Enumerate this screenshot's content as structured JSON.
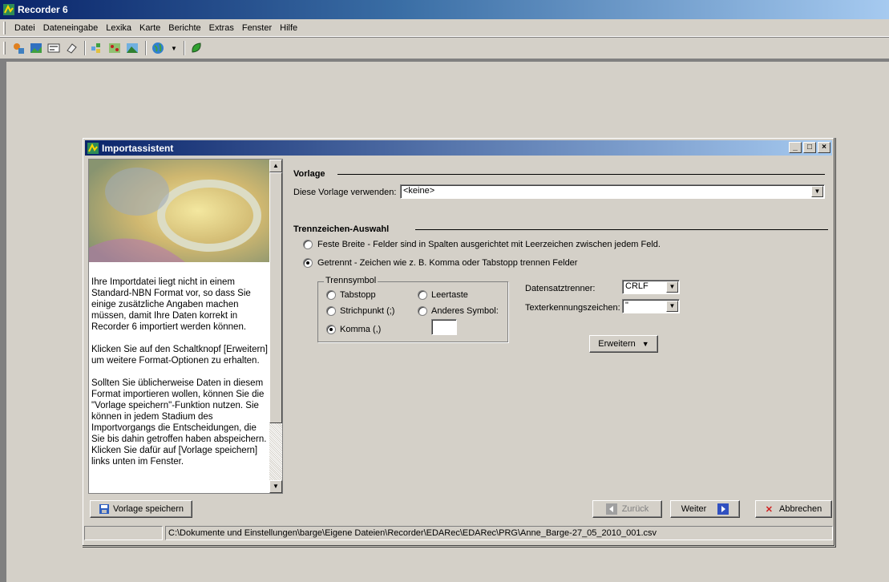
{
  "app": {
    "title": "Recorder 6",
    "menu": [
      "Datei",
      "Dateneingabe",
      "Lexika",
      "Karte",
      "Berichte",
      "Extras",
      "Fenster",
      "Hilfe"
    ]
  },
  "dialog": {
    "title": "Importassistent",
    "help_paragraphs": [
      "Ihre Importdatei liegt nicht in einem Standard-NBN Format vor, so dass Sie einige zusätzliche Angaben machen müssen, damit Ihre Daten korrekt in Recorder 6 importiert werden können.",
      "Klicken Sie auf den Schaltknopf [Erweitern] um weitere Format-Optionen zu erhalten.",
      "Sollten Sie üblicherweise Daten in diesem Format importieren wollen, können Sie die \"Vorlage speichern\"-Funktion nutzen. Sie können in jedem Stadium des Importvorgangs die Entscheidungen, die Sie bis dahin getroffen haben abspeichern. Klicken Sie dafür auf [Vorlage speichern] links unten im Fenster."
    ],
    "vorlage": {
      "section_title": "Vorlage",
      "use_label": "Diese Vorlage verwenden:",
      "selected": "<keine>"
    },
    "trennzeichen": {
      "section_title": "Trennzeichen-Auswahl",
      "option_fixed": "Feste Breite - Felder sind in Spalten ausgerichtet mit Leerzeichen zwischen jedem Feld.",
      "option_delimited": "Getrennt - Zeichen wie z. B. Komma oder Tabstopp trennen Felder",
      "group_label": "Trennsymbol",
      "tab": "Tabstopp",
      "semicolon": "Strichpunkt (;)",
      "comma": "Komma (,)",
      "space": "Leertaste",
      "other": "Anderes Symbol:",
      "record_sep_label": "Datensatztrenner:",
      "record_sep_value": "CRLF",
      "text_qual_label": "Texterkennungszeichen:",
      "text_qual_value": "\"",
      "expand_button": "Erweitern"
    },
    "buttons": {
      "save_template": "Vorlage speichern",
      "back": "Zurück",
      "next": "Weiter",
      "cancel": "Abbrechen"
    },
    "status": {
      "left": "",
      "path": "C:\\Dokumente und Einstellungen\\barge\\Eigene Dateien\\Recorder\\EDARec\\EDARec\\PRG\\Anne_Barge-27_05_2010_001.csv"
    }
  }
}
